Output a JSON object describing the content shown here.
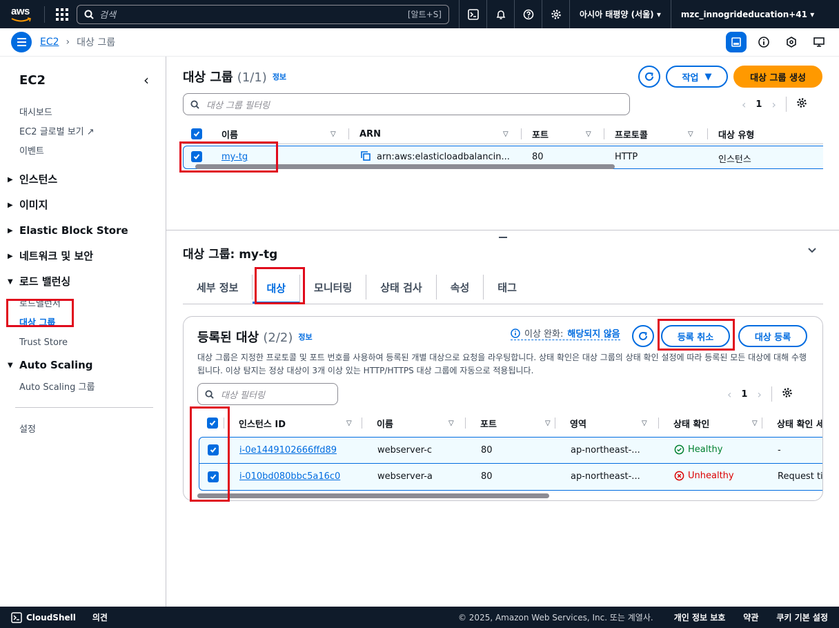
{
  "topnav": {
    "logo_text": "aws",
    "search_placeholder": "검색",
    "search_shortcut": "[알트+S]",
    "region": "아시아 태평양 (서울)",
    "account": "mzc_innogrideducation+41"
  },
  "breadcrumb": {
    "service": "EC2",
    "current": "대상 그룹"
  },
  "sidebar": {
    "title": "EC2",
    "top_links": [
      "대시보드",
      "EC2 글로벌 보기",
      "이벤트"
    ],
    "sections": [
      "인스턴스",
      "이미지",
      "Elastic Block Store",
      "네트워크 및 보안"
    ],
    "lb_section": "로드 밸런싱",
    "lb_items": [
      "로드밸런서",
      "대상 그룹",
      "Trust Store"
    ],
    "as_section": "Auto Scaling",
    "as_items": [
      "Auto Scaling 그룹"
    ],
    "settings": "설정"
  },
  "tg_list": {
    "title": "대상 그룹",
    "count": "(1/1)",
    "info": "정보",
    "actions_label": "작업",
    "create_label": "대상 그룹 생성",
    "filter_placeholder": "대상 그룹 필터링",
    "page": "1",
    "columns": [
      "이름",
      "ARN",
      "포트",
      "프로토콜",
      "대상 유형"
    ],
    "row": {
      "name": "my-tg",
      "arn": "arn:aws:elasticloadbalancin...",
      "port": "80",
      "protocol": "HTTP",
      "type": "인스턴스"
    }
  },
  "detail": {
    "title": "대상 그룹: my-tg",
    "tabs": [
      "세부 정보",
      "대상",
      "모니터링",
      "상태 검사",
      "속성",
      "태그"
    ],
    "active_tab": "대상",
    "registered": {
      "title": "등록된 대상",
      "count": "(2/2)",
      "info": "정보",
      "anomaly_label": "이상 완화:",
      "anomaly_value": "해당되지 않음",
      "deregister_label": "등록 취소",
      "register_label": "대상 등록",
      "description": "대상 그룹은 지정한 프로토콜 및 포트 번호를 사용하여 등록된 개별 대상으로 요청을 라우팅합니다. 상태 확인은 대상 그룹의 상태 확인 설정에 따라 등록된 모든 대상에 대해 수행됩니다. 이상 탐지는 정상 대상이 3개 이상 있는 HTTP/HTTPS 대상 그룹에 자동으로 적용됩니다.",
      "filter_placeholder": "대상 필터링",
      "page": "1",
      "columns": [
        "인스턴스 ID",
        "이름",
        "포트",
        "영역",
        "상태 확인",
        "상태 확인 세"
      ],
      "rows": [
        {
          "id": "i-0e1449102666ffd89",
          "name": "webserver-c",
          "port": "80",
          "zone": "ap-northeast-...",
          "health": "Healthy",
          "detail": "-"
        },
        {
          "id": "i-010bd080bbc5a16c0",
          "name": "webserver-a",
          "port": "80",
          "zone": "ap-northeast-...",
          "health": "Unhealthy",
          "detail": "Request ti"
        }
      ]
    }
  },
  "footer": {
    "cloudshell": "CloudShell",
    "feedback": "의견",
    "copyright": "© 2025, Amazon Web Services, Inc. 또는 계열사.",
    "privacy": "개인 정보 보호",
    "terms": "약관",
    "cookies": "쿠키 기본 설정"
  },
  "colors": {
    "accent": "#006ce0",
    "highlight": "#e00b1c",
    "primary_button": "#ff9900",
    "healthy": "#00802f",
    "unhealthy": "#db0000"
  }
}
